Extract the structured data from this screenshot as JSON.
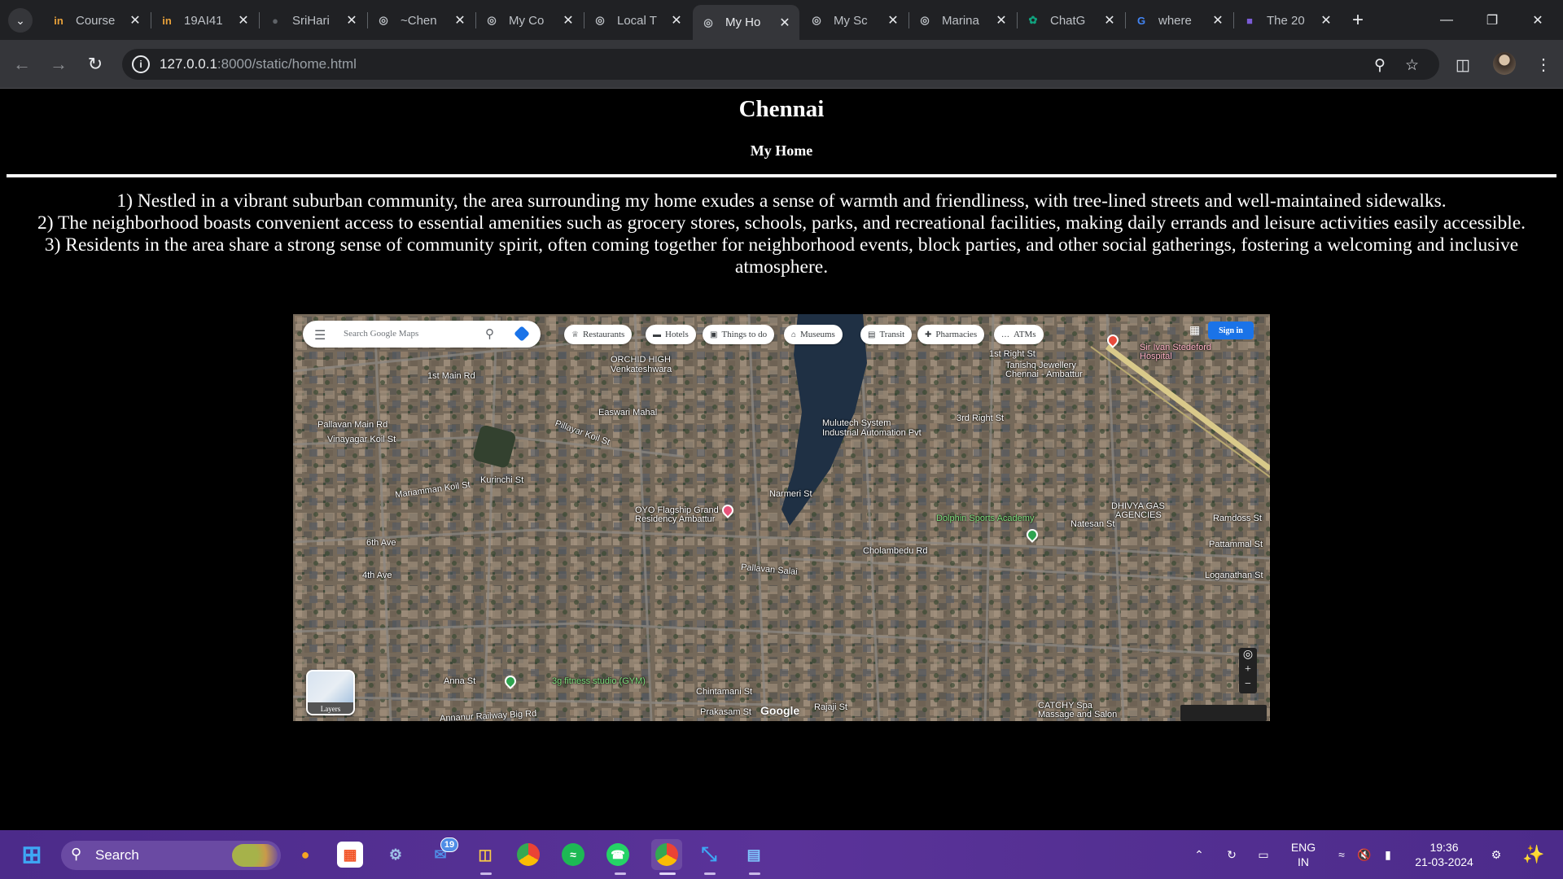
{
  "browser": {
    "tabs": [
      {
        "title": "Course",
        "favicon": "coursera-icon",
        "color": "#e8a13a",
        "active": false
      },
      {
        "title": "19AI41",
        "favicon": "coursera-icon",
        "color": "#e8a13a",
        "active": false
      },
      {
        "title": "SriHari",
        "favicon": "github-icon",
        "color": "#5f6368",
        "active": false
      },
      {
        "title": "~Chen",
        "favicon": "globe-icon",
        "color": "#bdc1c6",
        "active": false
      },
      {
        "title": "My Co",
        "favicon": "globe-icon",
        "color": "#bdc1c6",
        "active": false
      },
      {
        "title": "Local T",
        "favicon": "globe-icon",
        "color": "#bdc1c6",
        "active": false
      },
      {
        "title": "My Ho",
        "favicon": "globe-icon",
        "color": "#bdc1c6",
        "active": true
      },
      {
        "title": "My Sc",
        "favicon": "globe-icon",
        "color": "#bdc1c6",
        "active": false
      },
      {
        "title": "Marina",
        "favicon": "globe-icon",
        "color": "#bdc1c6",
        "active": false
      },
      {
        "title": "ChatG",
        "favicon": "chatgpt-icon",
        "color": "#10a37f",
        "active": false
      },
      {
        "title": "where",
        "favicon": "google-icon",
        "color": "#4285f4",
        "active": false
      },
      {
        "title": "The 20",
        "favicon": "site-icon",
        "color": "#7b5cd6",
        "active": false
      }
    ],
    "url_host": "127.0.0.1",
    "url_path": ":8000/static/home.html"
  },
  "page": {
    "title": "Chennai",
    "subtitle": "My Home",
    "points": [
      "1) Nestled in a vibrant suburban community, the area surrounding my home exudes a sense of warmth and friendliness, with tree-lined streets and well-maintained sidewalks.",
      "2) The neighborhood boasts convenient access to essential amenities such as grocery stores, schools, parks, and recreational facilities, making daily errands and leisure activities easily accessible.",
      "3) Residents in the area share a strong sense of community spirit, often coming together for neighborhood events, block parties, and other social gatherings, fostering a welcoming and inclusive atmosphere."
    ]
  },
  "map": {
    "search_placeholder": "Search Google Maps",
    "chips": [
      {
        "label": "Restaurants",
        "icon": "fork-knife-icon"
      },
      {
        "label": "Hotels",
        "icon": "bed-icon"
      },
      {
        "label": "Things to do",
        "icon": "camera-icon"
      },
      {
        "label": "Museums",
        "icon": "museum-icon"
      },
      {
        "label": "Transit",
        "icon": "transit-icon"
      },
      {
        "label": "Pharmacies",
        "icon": "pharmacy-icon"
      },
      {
        "label": "ATMs",
        "icon": "atm-icon"
      }
    ],
    "sign_in": "Sign in",
    "layers": "Layers",
    "watermark": "Google",
    "labels": {
      "orchid": "ORCHID HIGH",
      "venkateshwara": "Venkateshwara",
      "eswari": "Easwari Mahal",
      "kurinchi": "Kurinchi St",
      "oyo": "OYO Flagship Grand",
      "oyo2": "Residency Ambattur",
      "mulutech": "Mulutech System",
      "industrial": "Industrial Automation Pvt",
      "dolphin": "Dolphin Sports Academy",
      "dhivya": "DHIVYA GAS",
      "agencies": "AGENCIES",
      "tanishq": "Tanishq Jewellery",
      "tanishq2": "Chennai - Ambattur",
      "sirivan": "Sir Ivan Stedeford",
      "hospital": "Hospital",
      "cholambedu": "Cholambedu Rd",
      "pallavan": "Pallavan Salai",
      "narmeri": "Narmeri St",
      "fitness": "3g fitness studio (GYM)",
      "catchy": "CATCHY Spa",
      "massage": "Massage and Salon",
      "anna": "Anna St",
      "chintamani": "Chintamani St",
      "prakasam": "Prakasam St",
      "rajaji": "Rajaji St",
      "ramdoss": "Ramdoss St",
      "pattammal": "Pattammal St",
      "loganathan": "Loganathan St",
      "natesan": "Natesan St",
      "annanur": "Annanur Railway Big Rd",
      "first_main": "1st Main Rd",
      "pallavan_main": "Pallavan Main Rd",
      "vinayagar": "Vinayagar Koil St",
      "mariamman": "Mariamman Koil St",
      "sixth_ave": "6th Ave",
      "fourth_ave": "4th Ave",
      "pillayar": "Pillayar Koil St",
      "first_right": "1st Right St",
      "third_right": "3rd Right St"
    }
  },
  "taskbar": {
    "search_label": "Search",
    "mail_badge": "19",
    "lang_top": "ENG",
    "lang_bottom": "IN",
    "time": "19:36",
    "date": "21-03-2024"
  }
}
